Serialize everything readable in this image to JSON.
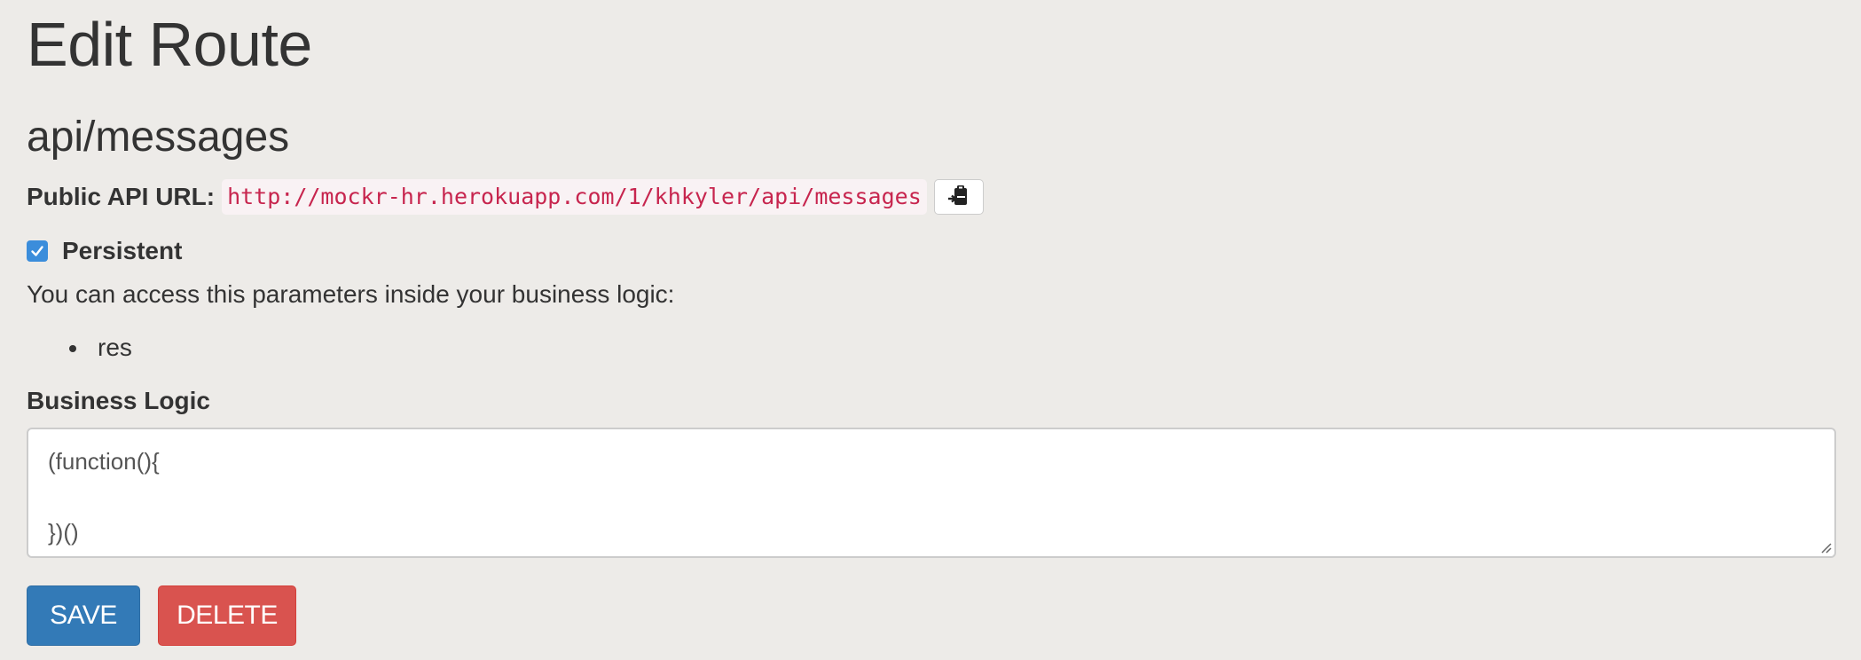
{
  "page": {
    "title": "Edit Route"
  },
  "route": {
    "name": "api/messages",
    "public_api_label": "Public API URL:",
    "public_api_url": "http://mockr-hr.herokuapp.com/1/khkyler/api/messages",
    "copy_icon": "clipboard-icon"
  },
  "persistent": {
    "label": "Persistent",
    "checked": true
  },
  "params": {
    "help_text": "You can access this parameters inside your business logic:",
    "items": [
      "res"
    ]
  },
  "business_logic": {
    "label": "Business Logic",
    "lines": [
      "(function(){",
      "",
      "})()"
    ]
  },
  "actions": {
    "save_label": "SAVE",
    "delete_label": "DELETE"
  },
  "colors": {
    "background": "#edebe8",
    "code_text": "#c7254e",
    "code_background": "#f9f2f4",
    "checkbox": "#3b8ddb",
    "save_button": "#337ab7",
    "delete_button": "#d9534f"
  }
}
